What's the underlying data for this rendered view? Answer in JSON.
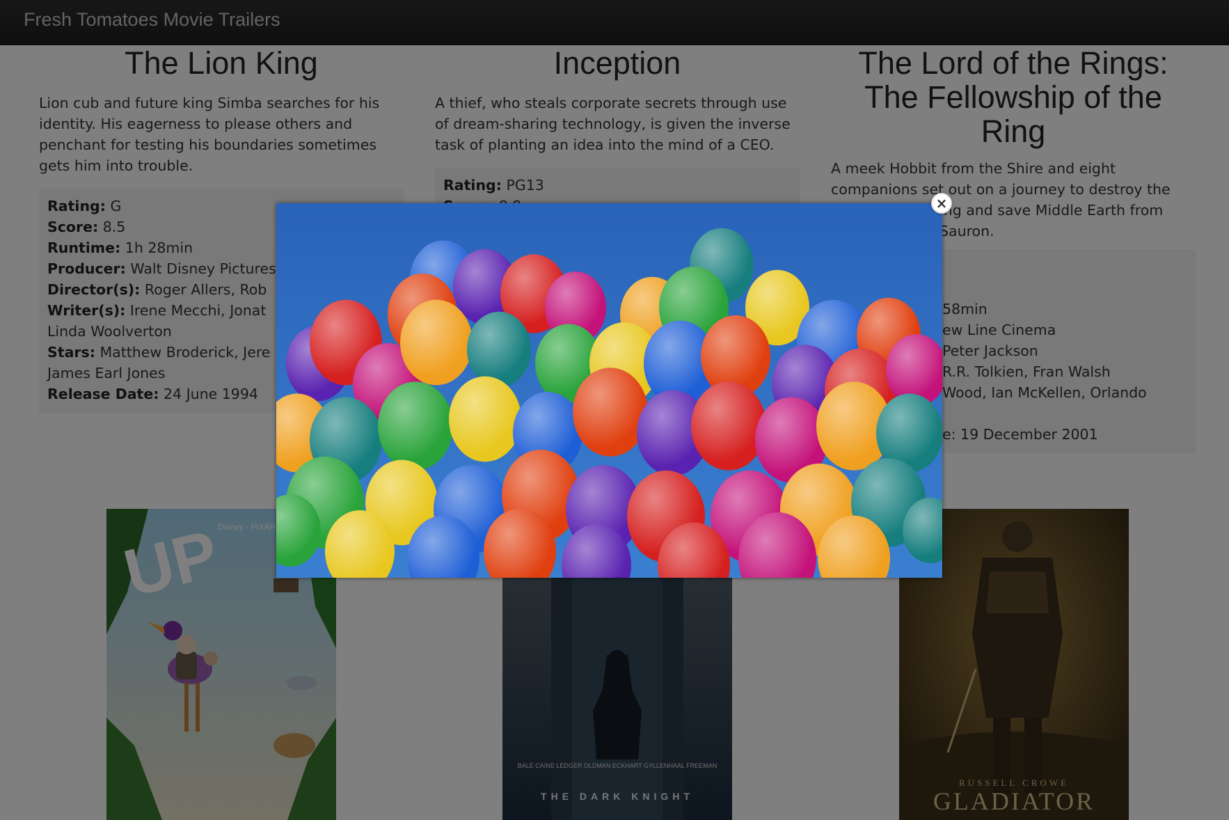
{
  "navbar": {
    "brand": "Fresh Tomatoes Movie Trailers"
  },
  "labels": {
    "rating": "Rating:",
    "score": "Score:",
    "runtime": "Runtime:",
    "producer": "Producer:",
    "directors": "Director(s):",
    "writers": "Writer(s):",
    "stars": "Stars:",
    "release_date": "Release Date:"
  },
  "movies": [
    {
      "title": "The Lion King",
      "storyline": "Lion cub and future king Simba searches for his identity. His eagerness to please others and penchant for testing his boundaries sometimes gets him into trouble.",
      "rating": "G",
      "score": "8.5",
      "runtime": "1h 28min",
      "producer": "Walt Disney Pictures",
      "directors": "Roger Allers, Rob",
      "writers": "Irene Mecchi, Jonat",
      "writers_line2": "Linda Woolverton",
      "stars": "Matthew Broderick, Jere",
      "stars_line2": "James Earl Jones",
      "release_date": "24 June 1994"
    },
    {
      "title": "Inception",
      "storyline": "A thief, who steals corporate secrets through use of dream-sharing technology, is given the inverse task of planting an idea into the mind of a CEO.",
      "rating": "PG13",
      "score": "8.8"
    },
    {
      "title_line1": "The Lord of the Rings:",
      "title_line2": "The Fellowship of the",
      "title_line3": "Ring",
      "storyline_1": "A meek Hobbit from the Shire and eight",
      "storyline_2": "companions set out on a journey to destroy the",
      "storyline_3": "ing and save Middle Earth from",
      "storyline_4": "Sauron.",
      "runtime_frag": "58min",
      "producer_frag": "ew Line Cinema",
      "director_frag": "Peter Jackson",
      "writer_frag": "R.R. Tolkien, Fran Walsh",
      "stars_frag": "Wood, Ian McKellen, Orlando",
      "release_frag": "e: 19 December 2001"
    }
  ],
  "posters": [
    {
      "name": "Up",
      "brand_text": "Disney · PIXAR",
      "title_text": "UP"
    },
    {
      "name": "The Dark Knight",
      "cast_text": "BALE CAINE LEDGER OLDMAN ECKHART GYLLENHAAL FREEMAN",
      "title_text": "THE DARK KNIGHT"
    },
    {
      "name": "Gladiator",
      "actor_text": "RUSSELL CROWE",
      "title_text": "GLADIATOR"
    }
  ],
  "modal": {
    "close_label": "×"
  },
  "colors": {
    "navbar": "#222222",
    "overlay": "rgba(0,0,0,0.5)",
    "sky": "#2f6fc4"
  }
}
